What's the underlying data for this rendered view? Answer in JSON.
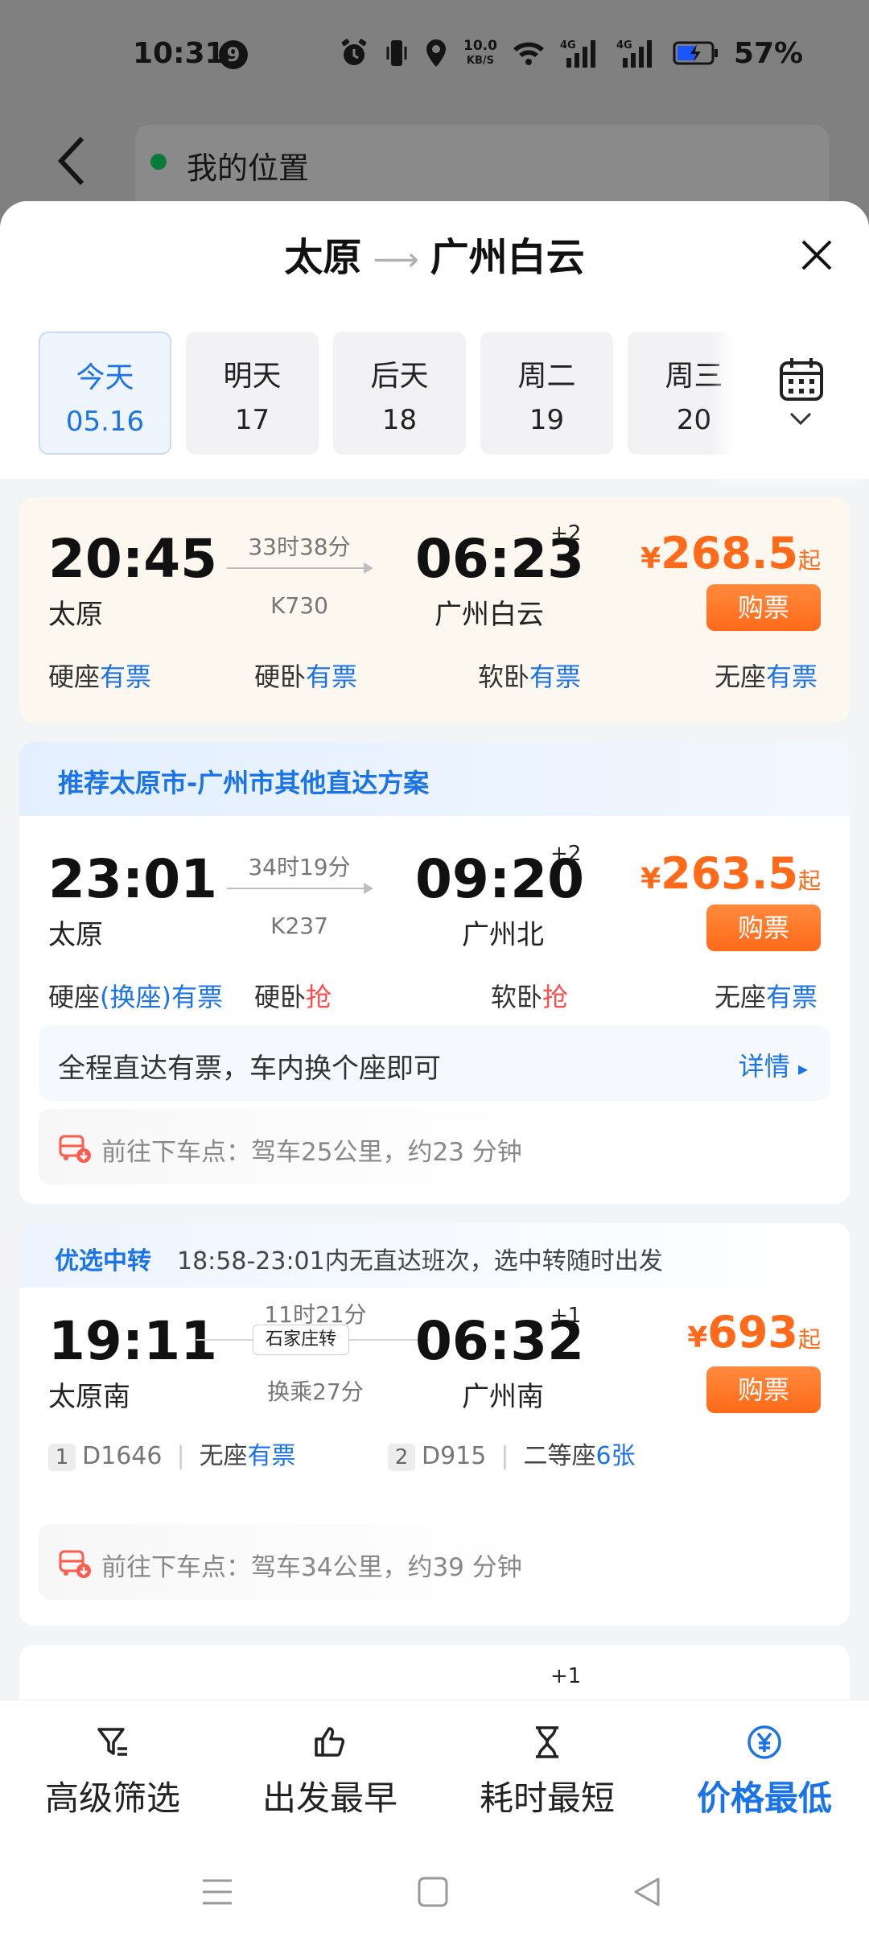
{
  "status": {
    "time": "10:31",
    "notif_count": "9",
    "net_speed_top": "10.0",
    "net_speed_bottom": "KB/S",
    "battery": "57%"
  },
  "background": {
    "location": "我的位置"
  },
  "sheet": {
    "from": "太原",
    "to": "广州白云"
  },
  "dates": [
    {
      "label": "今天",
      "date": "05.16",
      "active": true
    },
    {
      "label": "明天",
      "date": "17"
    },
    {
      "label": "后天",
      "date": "18"
    },
    {
      "label": "周二",
      "date": "19"
    },
    {
      "label": "周三",
      "date": "20"
    }
  ],
  "trains": [
    {
      "dep_time": "20:45",
      "dep_station": "太原",
      "duration": "33时38分",
      "train_no": "K730",
      "arr_time": "06:23",
      "arr_station": "广州白云",
      "day_offset": "+2",
      "price_sym": "¥",
      "price": "268.5",
      "price_suffix": "起",
      "buy": "购票",
      "seats": [
        {
          "name": "硬座",
          "status": "有票"
        },
        {
          "name": "硬卧",
          "status": "有票"
        },
        {
          "name": "软卧",
          "status": "有票"
        },
        {
          "name": "无座",
          "status": "有票"
        }
      ]
    },
    {
      "banner": "推荐太原市-广州市其他直达方案",
      "dep_time": "23:01",
      "dep_station": "太原",
      "duration": "34时19分",
      "train_no": "K237",
      "arr_time": "09:20",
      "arr_station": "广州北",
      "day_offset": "+2",
      "price_sym": "¥",
      "price": "263.5",
      "price_suffix": "起",
      "buy": "购票",
      "seats": [
        {
          "name": "硬座",
          "extra": "(换座)",
          "status": "有票"
        },
        {
          "name": "硬卧",
          "status": "抢"
        },
        {
          "name": "软卧",
          "status": "抢"
        },
        {
          "name": "无座",
          "status": "有票"
        }
      ],
      "info": "全程直达有票，车内换个座即可",
      "info_more": "详情",
      "drive": "前往下车点：驾车25公里，约23 分钟"
    },
    {
      "tag": "优选中转",
      "tag_desc": "18:58-23:01内无直达班次，选中转随时出发",
      "dep_time": "19:11",
      "dep_station": "太原南",
      "duration": "11时21分",
      "via": "石家庄转",
      "transfer": "换乘27分",
      "arr_time": "06:32",
      "arr_station": "广州南",
      "day_offset": "+1",
      "price_sym": "¥",
      "price": "693",
      "price_suffix": "起",
      "buy": "购票",
      "legs": [
        {
          "num": "1",
          "train": "D1646",
          "seat": "无座",
          "status": "有票"
        },
        {
          "num": "2",
          "train": "D915",
          "seat": "二等座",
          "status": "6张"
        }
      ],
      "drive": "前往下车点：驾车34公里，约39 分钟"
    },
    {
      "day_offset": "+1"
    }
  ],
  "bottom": [
    {
      "label": "高级筛选",
      "icon": "filter-icon"
    },
    {
      "label": "出发最早",
      "icon": "thumbs-up-icon"
    },
    {
      "label": "耗时最短",
      "icon": "hourglass-icon"
    },
    {
      "label": "价格最低",
      "icon": "yuan-circle-icon",
      "active": true
    }
  ],
  "colors": {
    "accent": "#1a73e8",
    "price": "#ff6a1a",
    "grab": "#ff4d4d"
  }
}
